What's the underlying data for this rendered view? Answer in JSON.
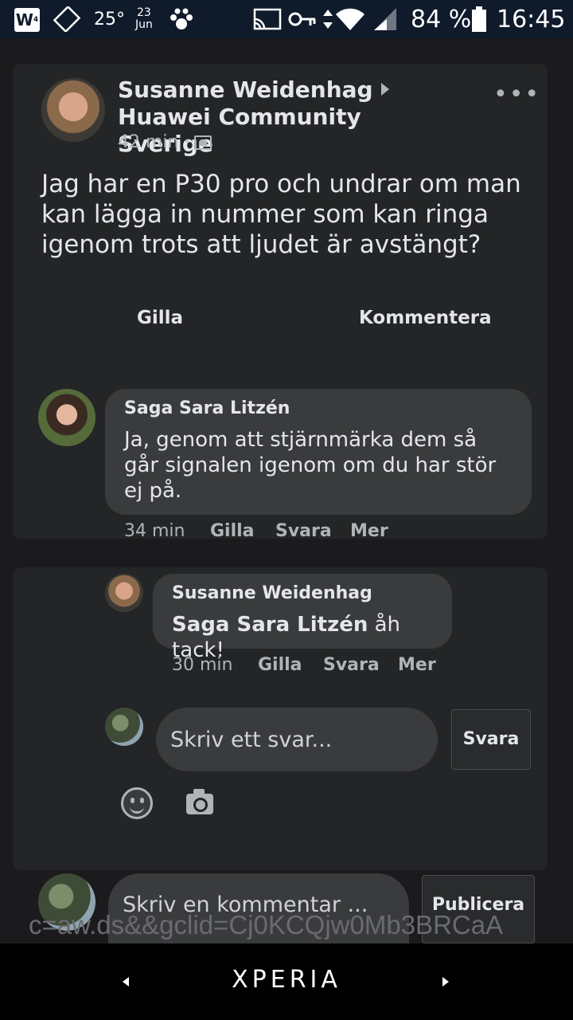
{
  "status_bar": {
    "app_badge": "W",
    "temperature": "25°",
    "date_day": "23",
    "date_month": "Jun",
    "battery": "84 %",
    "time": "16:45"
  },
  "post": {
    "author": "Susanne Weidenhag",
    "group": "Huawei Community Sverige",
    "time": "42 min ·",
    "text": "Jag har en P30 pro och undrar om man kan lägga in nummer som kan ringa igenom trots att ljudet är avstängt?",
    "like_label": "Gilla",
    "comment_label": "Kommentera"
  },
  "comments": [
    {
      "name": "Saga Sara Litzén",
      "text": "Ja, genom att stjärnmärka dem så går signalen igenom om du har stör ej på.",
      "time": "34 min",
      "like": "Gilla",
      "reply": "Svara",
      "more": "Mer"
    }
  ],
  "replies": [
    {
      "name": "Susanne Weidenhag",
      "mention": "Saga Sara Litzén",
      "text": " åh tack!",
      "time": "30 min",
      "like": "Gilla",
      "reply": "Svara",
      "more": "Mer"
    }
  ],
  "reply_box": {
    "placeholder": "Skriv ett svar...",
    "button": "Svara"
  },
  "comment_box": {
    "placeholder": "Skriv en kommentar ...",
    "button": "Publicera"
  },
  "url_overlay": "c=aw.ds&&gclid=Cj0KCQjw0Mb3BRCaA",
  "nav": {
    "brand": "XPERIA"
  }
}
